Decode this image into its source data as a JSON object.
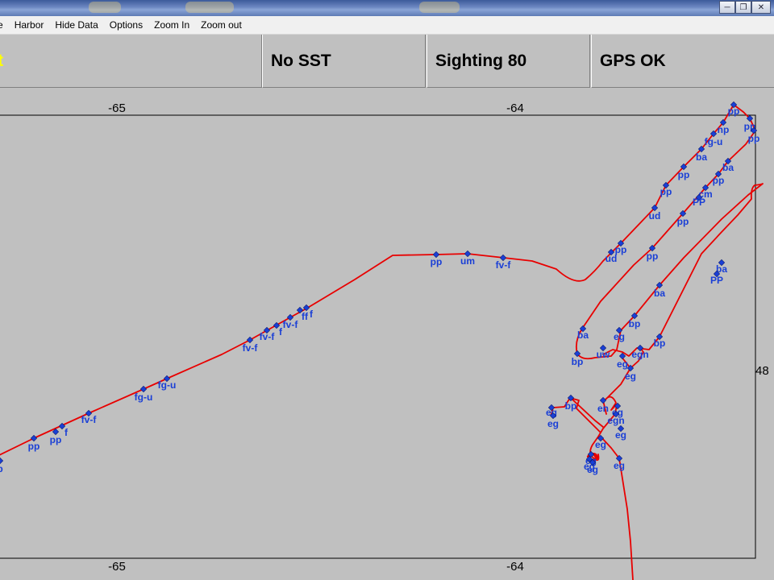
{
  "menu": {
    "items": [
      "e",
      "Harbor",
      "Hide Data",
      "Options",
      "Zoom In",
      "Zoom out"
    ]
  },
  "status": {
    "panel1": "rt",
    "panel2": "No SST",
    "panel3": "Sighting 80",
    "panel4": "GPS OK"
  },
  "map": {
    "axis_top": [
      "-65",
      "-64"
    ],
    "axis_bottom": [
      "-65",
      "-64"
    ],
    "axis_right": [
      "48"
    ],
    "colors": {
      "track": "#e80000",
      "label": "#1a3fd6",
      "background": "#c0c0c0"
    }
  },
  "sightings": [
    "p",
    "pp",
    "pp",
    "f",
    "fv-f",
    "fg-u",
    "fg-u",
    "fv-f",
    "fv-f",
    "f",
    "fv-f",
    "ff",
    "f",
    "pp",
    "um",
    "fv-f",
    "ud",
    "pp",
    "ud",
    "pp",
    "pp",
    "ba",
    "fg-u",
    "np",
    "pp",
    "pp",
    "pp",
    "ba",
    "pp",
    "cm",
    "PP",
    "pp",
    "pp",
    "ba",
    "PP",
    "ba",
    "ba",
    "bp",
    "bp",
    "eg",
    "uw",
    "egn",
    "eg",
    "eg",
    "bp",
    "eg",
    "eg",
    "bp",
    "eg",
    "en",
    "egn",
    "eg",
    "eg",
    "eg",
    "eg",
    "eg",
    "eg"
  ],
  "icons": {
    "minimize": "minimize-icon",
    "maximize": "maximize-icon",
    "close": "close-icon"
  }
}
